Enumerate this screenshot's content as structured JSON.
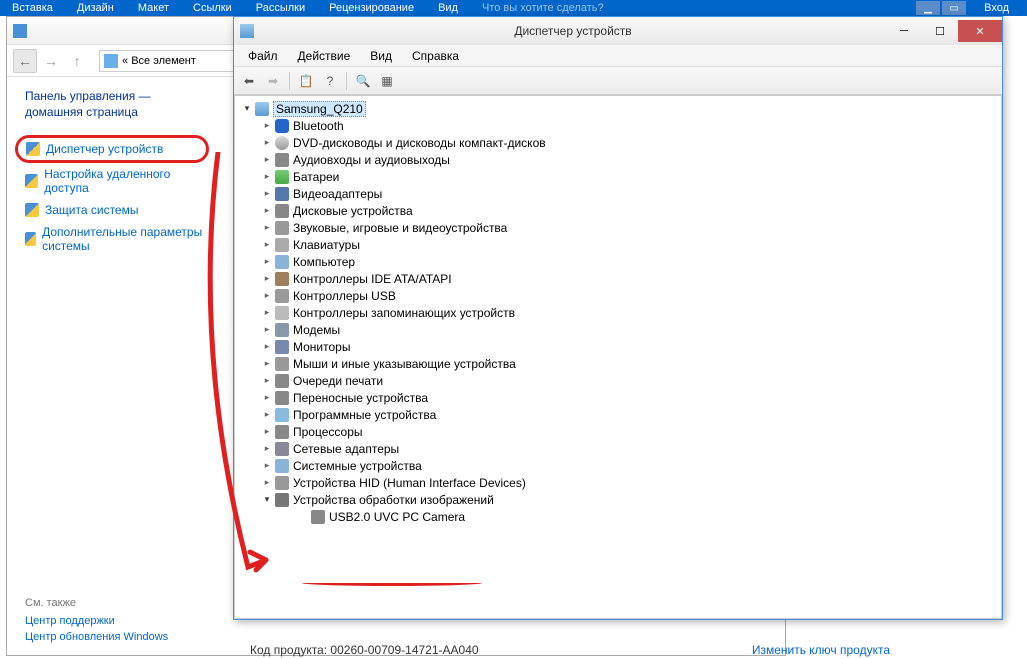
{
  "ribbon": {
    "items": [
      "Вставка",
      "Дизайн",
      "Макет",
      "Ссылки",
      "Рассылки",
      "Рецензирование",
      "Вид",
      "Что вы хотите сделать?"
    ],
    "right_label": "Вход"
  },
  "control_panel": {
    "breadcrumb_prefix": "«",
    "breadcrumb": "Все элемент",
    "sidebar_title": "Панель управления —",
    "sidebar_subtitle": "домашняя страница",
    "links": [
      {
        "label": "Диспетчер устройств",
        "highlighted": true
      },
      {
        "label": "Настройка удаленного доступа",
        "highlighted": false
      },
      {
        "label": "Защита системы",
        "highlighted": false
      },
      {
        "label": "Дополнительные параметры системы",
        "highlighted": false
      }
    ],
    "footer_title": "См. также",
    "footer_links": [
      "Центр поддержки",
      "Центр обновления Windows"
    ],
    "bottom_label": "Код продукта:",
    "bottom_value": "00260-00709-14721-AA040",
    "bottom_link": "Изменить ключ продукта"
  },
  "device_manager": {
    "title": "Диспетчер устройств",
    "menus": [
      "Файл",
      "Действие",
      "Вид",
      "Справка"
    ],
    "root": "Samsung_Q210",
    "categories": [
      {
        "label": "Bluetooth",
        "icon": "ic-bluetooth"
      },
      {
        "label": "DVD-дисководы и дисководы компакт-дисков",
        "icon": "ic-dvd"
      },
      {
        "label": "Аудиовходы и аудиовыходы",
        "icon": "ic-audio"
      },
      {
        "label": "Батареи",
        "icon": "ic-battery"
      },
      {
        "label": "Видеоадаптеры",
        "icon": "ic-video"
      },
      {
        "label": "Дисковые устройства",
        "icon": "ic-disk"
      },
      {
        "label": "Звуковые, игровые и видеоустройства",
        "icon": "ic-sound"
      },
      {
        "label": "Клавиатуры",
        "icon": "ic-keyboard"
      },
      {
        "label": "Компьютер",
        "icon": "ic-computer2"
      },
      {
        "label": "Контроллеры IDE ATA/ATAPI",
        "icon": "ic-ide"
      },
      {
        "label": "Контроллеры USB",
        "icon": "ic-usb"
      },
      {
        "label": "Контроллеры запоминающих устройств",
        "icon": "ic-storage"
      },
      {
        "label": "Модемы",
        "icon": "ic-modem"
      },
      {
        "label": "Мониторы",
        "icon": "ic-monitor"
      },
      {
        "label": "Мыши и иные указывающие устройства",
        "icon": "ic-mouse"
      },
      {
        "label": "Очереди печати",
        "icon": "ic-print"
      },
      {
        "label": "Переносные устройства",
        "icon": "ic-portable"
      },
      {
        "label": "Программные устройства",
        "icon": "ic-soft"
      },
      {
        "label": "Процессоры",
        "icon": "ic-cpu"
      },
      {
        "label": "Сетевые адаптеры",
        "icon": "ic-net"
      },
      {
        "label": "Системные устройства",
        "icon": "ic-sys"
      },
      {
        "label": "Устройства HID (Human Interface Devices)",
        "icon": "ic-hid"
      }
    ],
    "expanded_category": {
      "label": "Устройства обработки изображений",
      "icon": "ic-img"
    },
    "expanded_child": {
      "label": "USB2.0 UVC PC Camera",
      "icon": "ic-cam"
    }
  }
}
